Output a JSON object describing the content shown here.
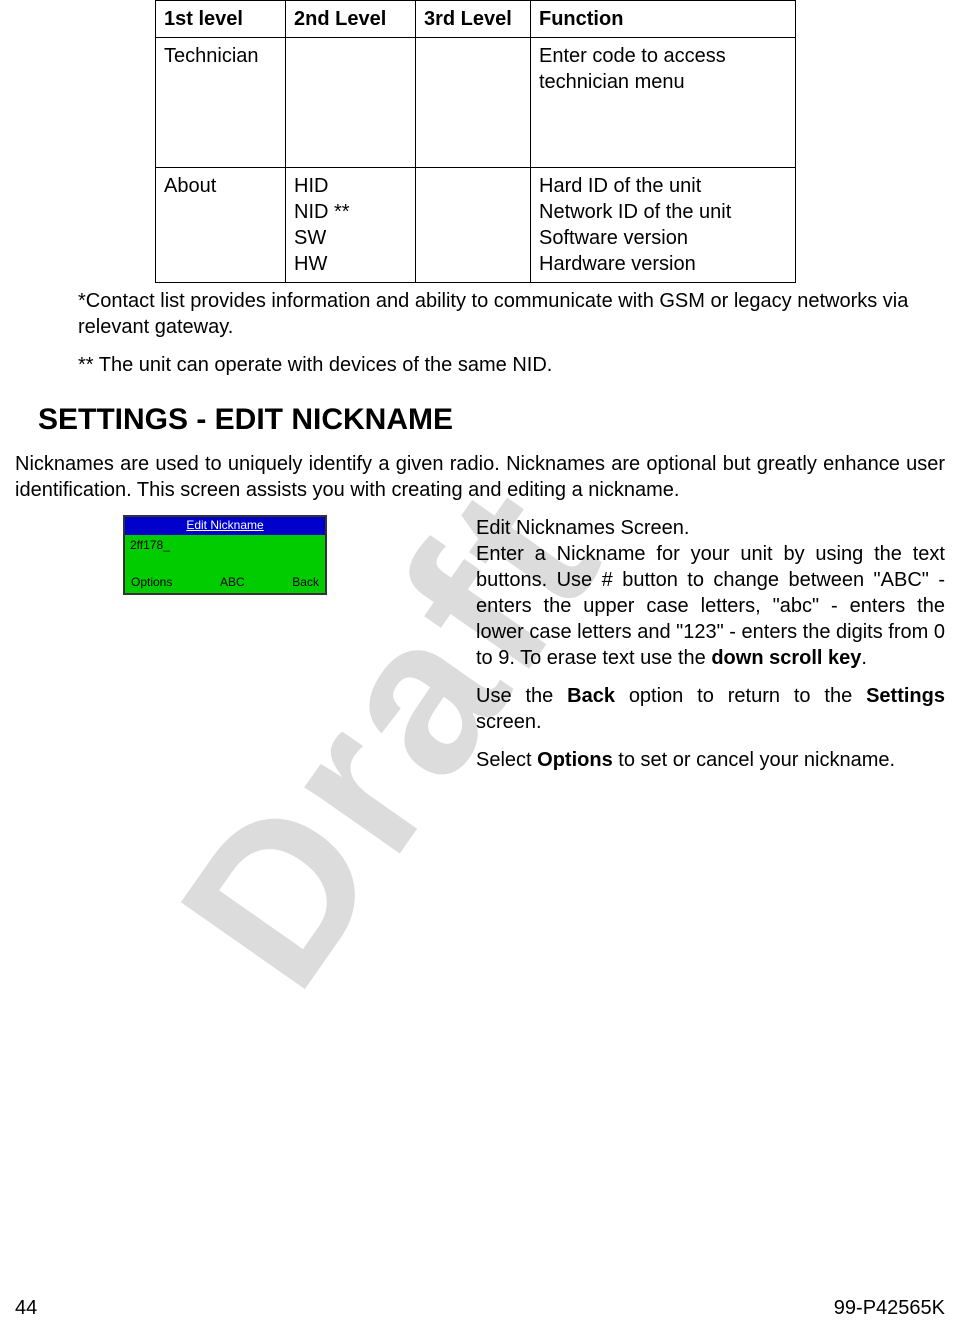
{
  "watermark": "Draft",
  "table": {
    "headers": [
      "1st level",
      "2nd Level",
      "3rd Level",
      "Function"
    ],
    "rows": [
      {
        "c1": "Technician",
        "c2": "",
        "c3": "",
        "c4": "Enter code to access technician menu"
      },
      {
        "c1": "About",
        "c2": "HID\nNID **\nSW\nHW",
        "c3": "",
        "c4": "Hard ID of the unit\nNetwork ID of the unit\nSoftware version\nHardware version"
      }
    ]
  },
  "note1": "*Contact list provides information and ability to communicate with GSM or legacy networks via relevant gateway.",
  "note2": "** The unit can operate with devices of the same NID.",
  "heading": "SETTINGS - EDIT NICKNAME",
  "intro": "Nicknames are used to uniquely identify a given radio. Nicknames are optional but greatly enhance user identification. This screen assists you with creating and editing a nickname.",
  "screen": {
    "title": "Edit Nickname",
    "value": "2ff178_",
    "left": "Options",
    "center": "ABC",
    "right": "Back"
  },
  "desc": {
    "title": "Edit Nicknames Screen.",
    "p1a": "Enter a Nickname for your unit by using the text buttons. Use # button to change between \"ABC\"  - enters the upper case letters, \"abc\"  - enters the lower case letters and \"123\"  - enters the digits from 0 to 9. To erase text use the ",
    "p1b": "down scroll key",
    "p1c": ".",
    "p2a": " Use the ",
    "p2b": "Back",
    "p2c": " option to return to the ",
    "p2d": "Settings",
    "p2e": " screen.",
    "p3a": "Select ",
    "p3b": "Options",
    "p3c": " to set or cancel your nickname."
  },
  "footer": {
    "left": "44",
    "right": "99-P42565K"
  }
}
